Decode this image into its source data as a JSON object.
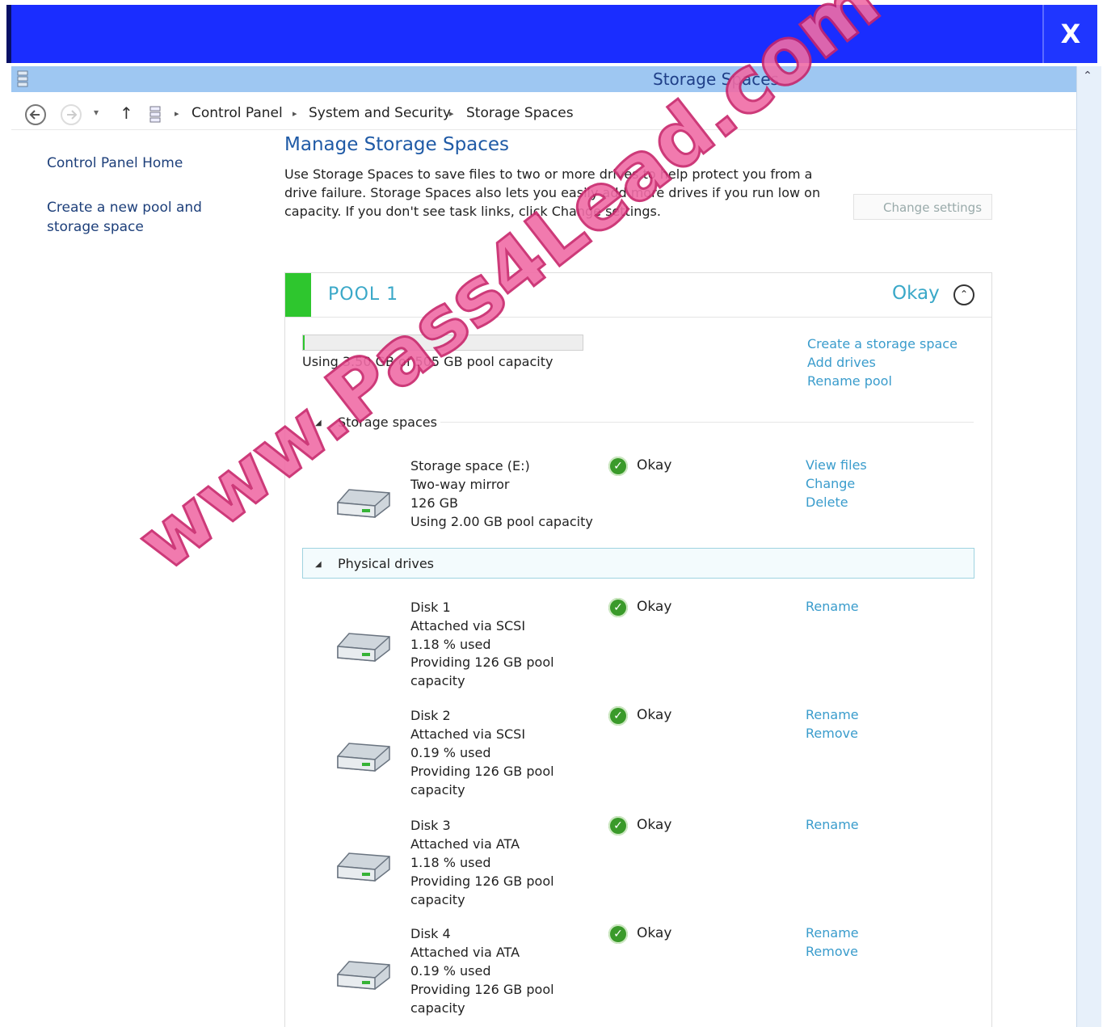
{
  "window": {
    "title": "Storage Spaces",
    "close_label": "X"
  },
  "address_bar": {
    "breadcrumbs": [
      "Control Panel",
      "System and Security",
      "Storage Spaces"
    ]
  },
  "sidebar": {
    "items": [
      {
        "label": "Control Panel Home"
      },
      {
        "label": "Create a new pool and storage space"
      }
    ]
  },
  "main": {
    "title": "Manage Storage Spaces",
    "intro": "Use Storage Spaces to save files to two or more drives to help protect you from a drive failure. Storage Spaces also lets you easily add more drives if you run low on capacity. If you don't see task links, click Change settings.",
    "change_settings_label": "Change settings"
  },
  "pool": {
    "name": "POOL 1",
    "status": "Okay",
    "usage_text": "Using 3.50 GB of 505 GB pool capacity",
    "usage_fraction": 0.007,
    "links": [
      "Create a storage space",
      "Add drives",
      "Rename pool"
    ]
  },
  "storage_spaces": {
    "section_label": "Storage spaces",
    "items": [
      {
        "lines": [
          "Storage space (E:)",
          "Two-way mirror",
          "126 GB",
          "Using 2.00 GB pool capacity"
        ],
        "status": "Okay",
        "actions": [
          "View files",
          "Change",
          "Delete"
        ]
      }
    ]
  },
  "physical_drives": {
    "section_label": "Physical drives",
    "items": [
      {
        "lines": [
          "Disk 1",
          "Attached via SCSI",
          "1.18 % used",
          "Providing 126 GB pool",
          "capacity"
        ],
        "status": "Okay",
        "actions": [
          "Rename"
        ]
      },
      {
        "lines": [
          "Disk 2",
          "Attached via SCSI",
          "0.19 % used",
          "Providing 126 GB pool",
          "capacity"
        ],
        "status": "Okay",
        "actions": [
          "Rename",
          "Remove"
        ]
      },
      {
        "lines": [
          "Disk 3",
          "Attached via ATA",
          "1.18 % used",
          "Providing 126 GB pool",
          "capacity"
        ],
        "status": "Okay",
        "actions": [
          "Rename"
        ]
      },
      {
        "lines": [
          "Disk 4",
          "Attached via ATA",
          "0.19 % used",
          "Providing 126 GB pool",
          "capacity"
        ],
        "status": "Okay",
        "actions": [
          "Rename",
          "Remove"
        ]
      }
    ]
  },
  "watermark": "www.Pass4Lead.com",
  "colors": {
    "title_bar_blue": "#1a2dff",
    "window_bar": "#9ec7f2",
    "link_blue": "#3a9ccc",
    "pool_green": "#2ec62e",
    "watermark_pink": "#f06ca6"
  }
}
